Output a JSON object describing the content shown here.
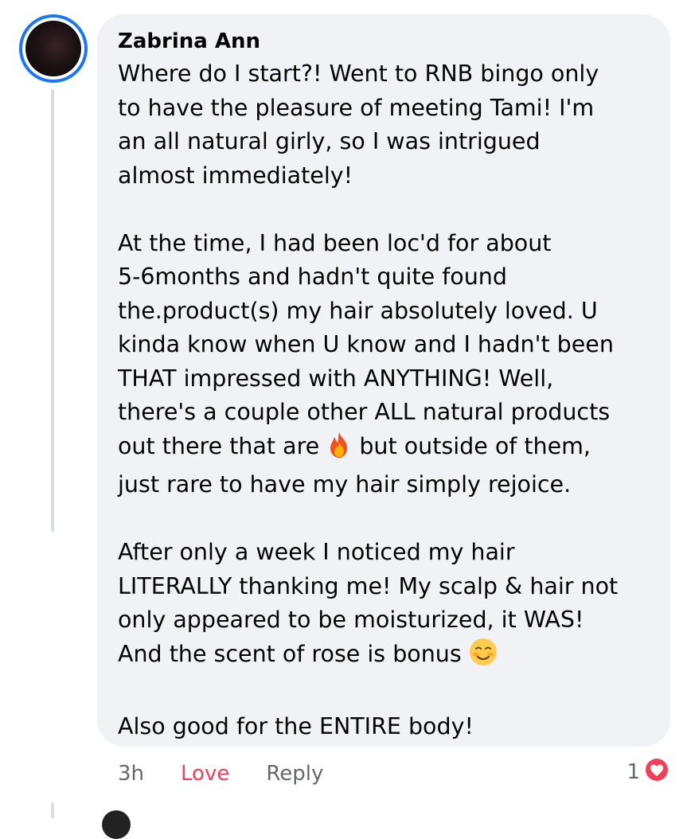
{
  "comment": {
    "author": "Zabrina Ann",
    "paragraphs": [
      [
        "Where do I start?! Went to RNB bingo only",
        "to have the pleasure of meeting Tami! I'm",
        "an all natural girly, so I was intrigued",
        "almost immediately!"
      ],
      [
        "At the time, I had been loc'd for about",
        "5-6months and hadn't quite found",
        "the.product(s) my hair absolutely loved. U",
        "kinda know when U know and I hadn't been",
        "THAT impressed with ANYTHING! Well,",
        "there's a couple other ALL natural products",
        "just rare to have my hair simply rejoice."
      ],
      [
        "After only a week I noticed my hair",
        "LITERALLY thanking me! My scalp & hair not",
        "only appeared to be moisturized, it WAS!"
      ],
      [
        "Also good for the ENTIRE body!"
      ]
    ],
    "fire_line_before": "out there that are",
    "fire_line_after": "but outside of them,",
    "rose_line": "And the scent of rose is bonus",
    "fire_emoji": "fire-icon",
    "smile_emoji": "smiling-face-icon"
  },
  "actions": {
    "time": "3h",
    "love_label": "Love",
    "reply_label": "Reply"
  },
  "reactions": {
    "count": "1",
    "type": "love-reaction-icon",
    "color": "#f33e58"
  },
  "colors": {
    "bubble": "#f0f2f5",
    "avatar_ring": "#1877f2",
    "love": "#f33e58",
    "meta": "#65676b"
  }
}
